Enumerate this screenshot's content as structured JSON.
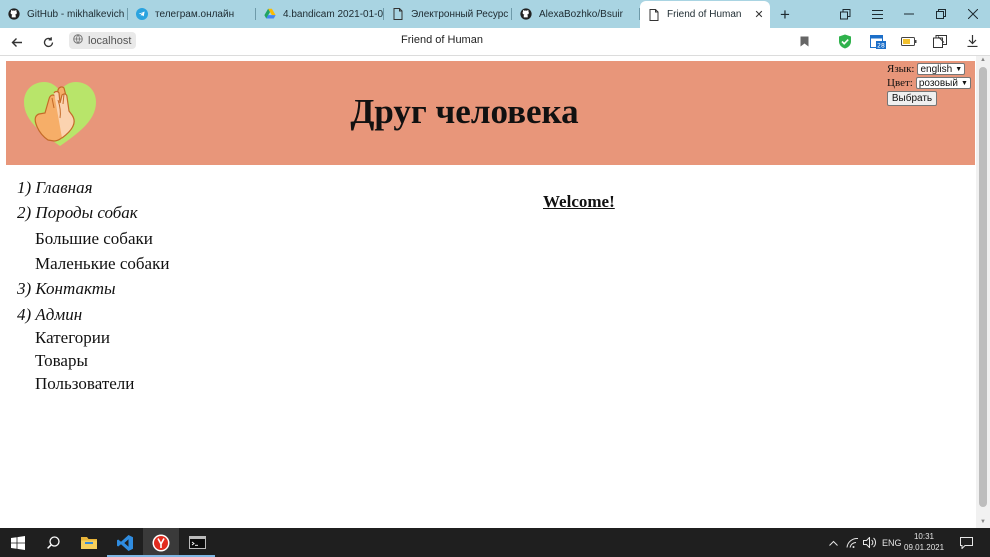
{
  "browser": {
    "tabs": [
      {
        "title": "GitHub - mikhalkevich",
        "icon": "github-icon"
      },
      {
        "title": "телеграм.онлайн",
        "icon": "telegram-icon"
      },
      {
        "title": "4.bandicam 2021-01-0",
        "icon": "google-drive-icon"
      },
      {
        "title": "Электронный Ресурс",
        "icon": "document-icon"
      },
      {
        "title": "AlexaBozhko/Bsuir",
        "icon": "github-icon"
      },
      {
        "title": "Friend of Human",
        "icon": "document-icon",
        "active": true
      }
    ],
    "new_tab": "+",
    "close_glyph": "✕",
    "address": "localhost",
    "page_title": "Friend of Human"
  },
  "page": {
    "site_title": "Друг человека",
    "language": {
      "label": "Язык:",
      "value": "english"
    },
    "color": {
      "label": "Цвет:",
      "value": "розовый"
    },
    "submit": "Выбрать",
    "menu": [
      {
        "text": "1) Главная",
        "kind": "main"
      },
      {
        "text": "2) Породы собак",
        "kind": "main"
      },
      {
        "text": "Большие собаки",
        "kind": "sub"
      },
      {
        "text": "Маленькие собаки",
        "kind": "sub"
      },
      {
        "text": "3) Контакты",
        "kind": "main"
      },
      {
        "text": "4) Админ",
        "kind": "main"
      },
      {
        "text": "Категории",
        "kind": "sub"
      },
      {
        "text": "Товары",
        "kind": "sub"
      },
      {
        "text": "Пользователи",
        "kind": "sub"
      }
    ],
    "welcome": "Welcome!",
    "header_color": "#e8967a"
  },
  "taskbar": {
    "lang": "ENG",
    "time": "10:31",
    "date": "09.01.2021"
  }
}
